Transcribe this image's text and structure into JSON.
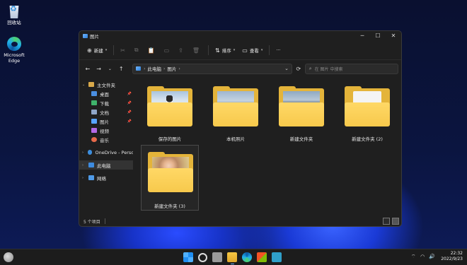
{
  "desktop": {
    "icons": [
      {
        "label": "回收站",
        "icon": "recycle-bin-icon"
      },
      {
        "label": "Microsoft Edge",
        "icon": "edge-icon"
      }
    ]
  },
  "window": {
    "title": "图片",
    "controls": {
      "minimize": "─",
      "maximize": "☐",
      "close": "✕"
    },
    "toolbar": {
      "new_label": "新建",
      "sort_label": "排序",
      "view_label": "查看",
      "more_label": "···"
    },
    "nav": {
      "back": "←",
      "forward": "→",
      "dropdown": "⌄",
      "up": "↑",
      "refresh": "⟳"
    },
    "address": {
      "crumbs": [
        "此电脑",
        "图片"
      ],
      "dropdown": "⌄"
    },
    "search": {
      "placeholder": "在 图片 中搜索"
    },
    "sidebar": {
      "home": "主文件夹",
      "quick": [
        {
          "label": "桌面",
          "color": "#4a8ee0"
        },
        {
          "label": "下载",
          "color": "#3fb36b"
        },
        {
          "label": "文档",
          "color": "#8fa6c8"
        },
        {
          "label": "图片",
          "color": "#59a4ff"
        },
        {
          "label": "视频",
          "color": "#b469e6"
        },
        {
          "label": "音乐",
          "color": "#e86a4a"
        }
      ],
      "onedrive": "OneDrive - Persona",
      "thispc": "此电脑",
      "network": "网络"
    },
    "folders": [
      {
        "label": "保存的图片"
      },
      {
        "label": "本机照片"
      },
      {
        "label": "新建文件夹"
      },
      {
        "label": "新建文件夹 (2)"
      },
      {
        "label": "新建文件夹 (3)"
      }
    ],
    "status": {
      "count": "5 个项目"
    }
  },
  "taskbar": {
    "time": "22:32",
    "date": "2022/9/23"
  }
}
